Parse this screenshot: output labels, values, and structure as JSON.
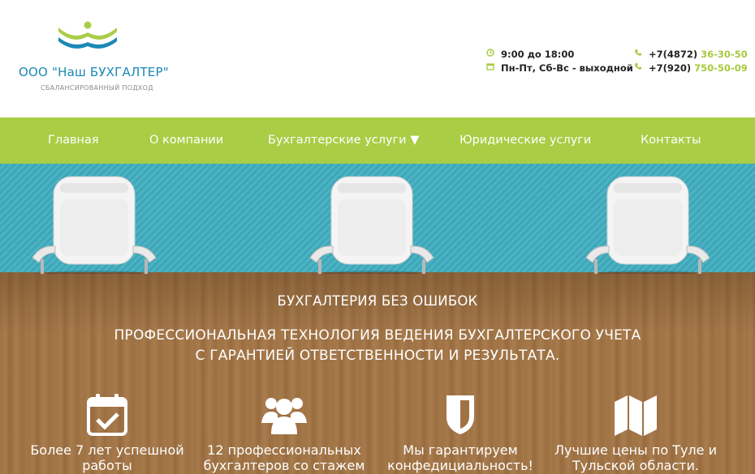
{
  "header": {
    "company": "ООО \"Наш БУХГАЛТЕР\"",
    "slogan": "СБАЛАНСИРОВАННЫЙ ПОДХОД",
    "hours": "9:00 до 18:00",
    "days": "Пн-Пт, Сб-Вс - выходной",
    "phones": [
      {
        "prefix": "+7(4872)",
        "number": "36-30-50"
      },
      {
        "prefix": "+7(920)",
        "number": "750-50-09"
      }
    ],
    "icons": {
      "clock": "clock-icon",
      "calendar": "calendar-icon",
      "phone": "phone-icon"
    }
  },
  "nav": {
    "items": [
      {
        "label": "Главная"
      },
      {
        "label": "О компании"
      },
      {
        "label": "Бухгалтерские услуги ▼"
      },
      {
        "label": "Юридические услуги"
      },
      {
        "label": "Контакты"
      }
    ]
  },
  "hero": {
    "headline": "БУХГАЛТЕРИЯ БЕЗ ОШИБОК",
    "subline_1": "ПРОФЕССИОНАЛЬНАЯ ТЕХНОЛОГИЯ ВЕДЕНИЯ БУХГАЛТЕРСКОГО УЧЕТА",
    "subline_2": "С ГАРАНТИЕЙ ОТВЕТСТВЕННОСТИ И РЕЗУЛЬТАТА."
  },
  "features": [
    {
      "icon": "calendar-check-icon",
      "text_1": "Более 7 лет успешной",
      "text_2": "работы"
    },
    {
      "icon": "users-icon",
      "text_1": "12 профессиональных",
      "text_2": "бухгалтеров со стажем"
    },
    {
      "icon": "shield-icon",
      "text_1": "Мы гарантируем",
      "text_2": "конфедициальность!"
    },
    {
      "icon": "map-icon",
      "text_1": "Лучшие цены по Туле и",
      "text_2": "Тульской области."
    }
  ],
  "colors": {
    "brand_blue": "#1b88b5",
    "brand_green": "#a9cd45",
    "wall_teal": "#3fa6b8",
    "floor_wood": "#a07345"
  }
}
